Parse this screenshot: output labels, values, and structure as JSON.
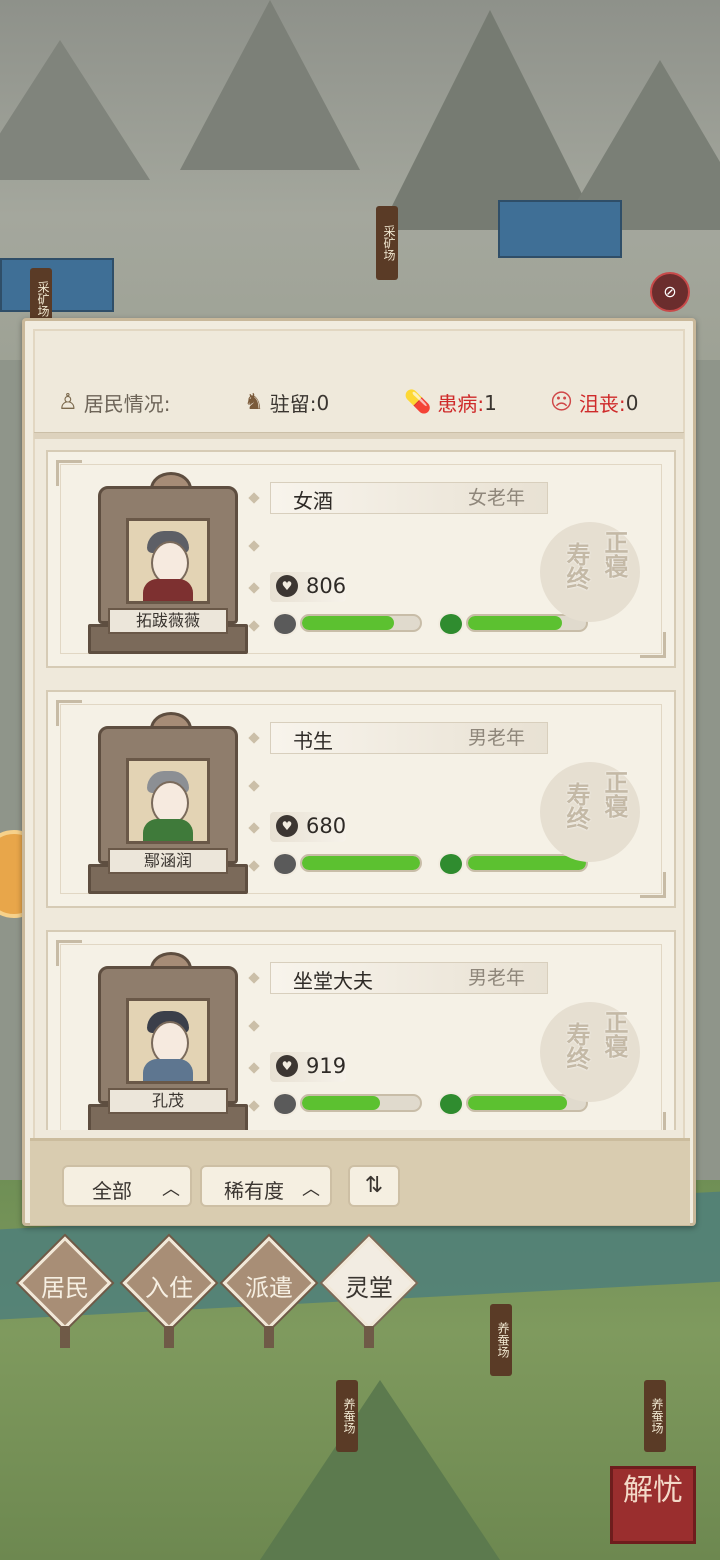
{
  "map": {
    "signs": [
      "采矿场",
      "采矿场",
      "养蚕场",
      "养蚕场",
      "养蚕场"
    ],
    "corner_button": "解忧"
  },
  "stats": {
    "title": "居民情况:",
    "stay_label": "驻留:",
    "stay_value": "0",
    "sick_label": "患病:",
    "sick_value": "1",
    "depressed_label": "沮丧:",
    "depressed_value": "0"
  },
  "residents": [
    {
      "name": "拓跋薇薇",
      "job": "女酒",
      "age_group": "女老年",
      "life": "806",
      "health": 0.78,
      "mood": 0.8,
      "stamp": [
        "寿终",
        "正寝"
      ]
    },
    {
      "name": "鄢涵润",
      "job": "书生",
      "age_group": "男老年",
      "life": "680",
      "health": 1.0,
      "mood": 1.0,
      "stamp": [
        "寿终",
        "正寝"
      ]
    },
    {
      "name": "孔茂",
      "job": "坐堂大夫",
      "age_group": "男老年",
      "life": "919",
      "health": 0.66,
      "mood": 0.84,
      "stamp": [
        "寿终",
        "正寝"
      ]
    }
  ],
  "filters": {
    "all_label": "全部",
    "rarity_label": "稀有度",
    "sort_icon": "sort-icon"
  },
  "tabs": [
    {
      "label": "居民",
      "active": false
    },
    {
      "label": "入住",
      "active": false
    },
    {
      "label": "派遣",
      "active": false
    },
    {
      "label": "灵堂",
      "active": true
    }
  ],
  "colors": {
    "health_fill": "#5cc130",
    "alert_red": "#cf2a2a",
    "panel_bg": "#f1ecdf"
  }
}
